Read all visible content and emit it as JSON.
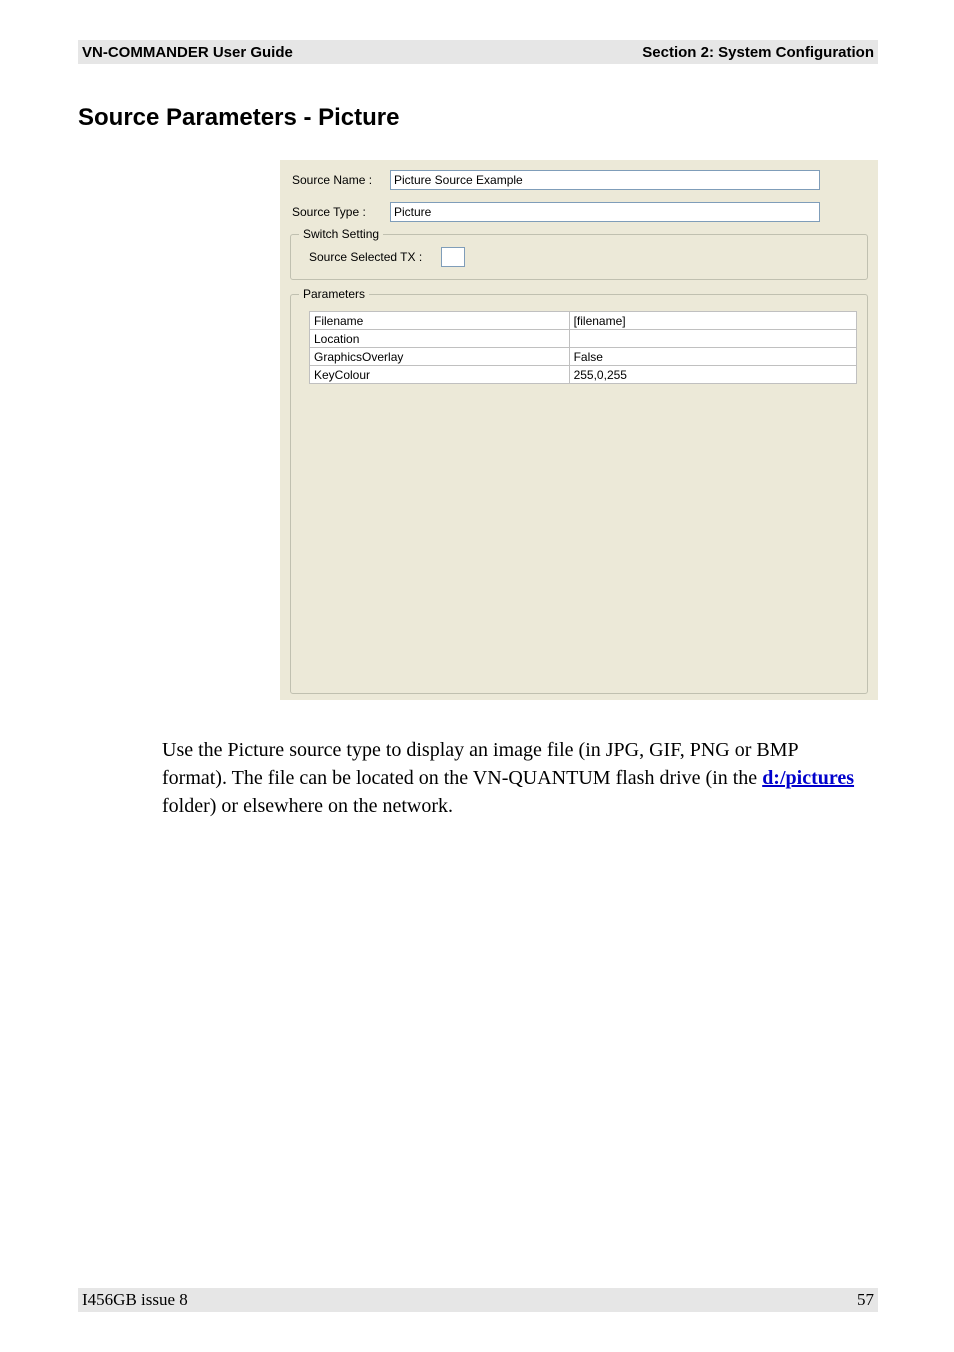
{
  "header": {
    "left": "VN-COMMANDER User Guide",
    "right": "Section 2: System Configuration"
  },
  "section_title": "Source Parameters - Picture",
  "form": {
    "source_name_label": "Source Name :",
    "source_name_value": "Picture Source Example",
    "source_type_label": "Source Type :",
    "source_type_value": "Picture",
    "switch_setting_title": "Switch Setting",
    "source_selected_tx_label": "Source Selected TX :",
    "source_selected_tx_value": "",
    "parameters_title": "Parameters",
    "parameters": [
      {
        "key": "Filename",
        "value": "[filename]"
      },
      {
        "key": "Location",
        "value": ""
      },
      {
        "key": "GraphicsOverlay",
        "value": "False"
      },
      {
        "key": "KeyColour",
        "value": "255,0,255"
      }
    ]
  },
  "body": {
    "part1": "Use the Picture source type to display an image file (in JPG, GIF, PNG or BMP format). The file can be located on the VN-QUANTUM flash drive (in the ",
    "link_text": "d:/pictures",
    "part2": " folder) or elsewhere on the network."
  },
  "footer": {
    "left": "I456GB issue 8",
    "right": "57"
  }
}
